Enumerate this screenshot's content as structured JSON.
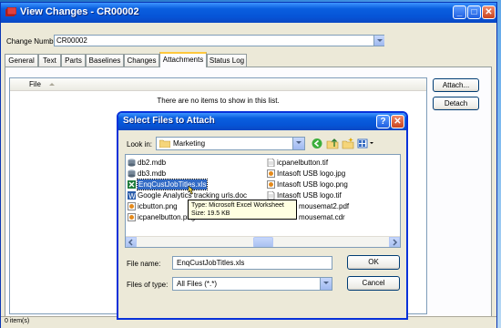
{
  "window": {
    "title": "View Changes - CR00002",
    "change_number_label": "Change Number:",
    "change_number_value": "CR00002",
    "controls": {
      "minimize": "_",
      "maximize": "□",
      "close": "✕"
    }
  },
  "tabs": [
    {
      "label": "General",
      "active": false
    },
    {
      "label": "Text",
      "active": false
    },
    {
      "label": "Parts",
      "active": false
    },
    {
      "label": "Baselines",
      "active": false
    },
    {
      "label": "Changes",
      "active": false
    },
    {
      "label": "Attachments",
      "active": true
    },
    {
      "label": "Status Log",
      "active": false
    }
  ],
  "attachments": {
    "column_header": "File",
    "empty_message": "There are no items to show in this list.",
    "attach_button": "Attach...",
    "detach_button": "Detach"
  },
  "status_bar": {
    "text": "0 item(s)"
  },
  "dialog": {
    "title": "Select Files to Attach",
    "help": "?",
    "close": "✕",
    "look_in_label": "Look in:",
    "look_in_value": "Marketing",
    "files_left": [
      {
        "name": "db2.mdb",
        "icon": "database-icon",
        "selected": false
      },
      {
        "name": "db3.mdb",
        "icon": "database-icon",
        "selected": false
      },
      {
        "name": "EnqCustJobTitles.xls",
        "icon": "excel-icon",
        "selected": true
      },
      {
        "name": "Google Analytics tracking urls.doc",
        "icon": "word-icon",
        "selected": false
      },
      {
        "name": "icbutton.png",
        "icon": "image-icon",
        "selected": false
      },
      {
        "name": "icpanelbutton.png",
        "icon": "image-icon",
        "selected": false
      }
    ],
    "files_right": [
      {
        "name": "icpanelbutton.tif",
        "icon": "document-icon"
      },
      {
        "name": "Intasoft USB logo.jpg",
        "icon": "image-icon"
      },
      {
        "name": "Intasoft USB logo.png",
        "icon": "image-icon"
      },
      {
        "name": "Intasoft USB logo.tif",
        "icon": "document-icon"
      },
      {
        "name": "mousemat2.pdf",
        "icon": "pdf-icon"
      },
      {
        "name": "mousemat.cdr",
        "icon": "image-icon"
      }
    ],
    "tooltip": {
      "line1": "Type: Microsoft Excel Worksheet",
      "line2": "Size: 19.5 KB"
    },
    "file_name_label": "File name:",
    "file_name_value": "EnqCustJobTitles.xls",
    "files_of_type_label": "Files of type:",
    "files_of_type_value": "All Files (*.*)",
    "ok_button": "OK",
    "cancel_button": "Cancel"
  },
  "colors": {
    "titlebar": "#0a5fdf",
    "selection": "#316ac5",
    "dialog_face": "#ece9d8",
    "tooltip_bg": "#ffffe1"
  }
}
